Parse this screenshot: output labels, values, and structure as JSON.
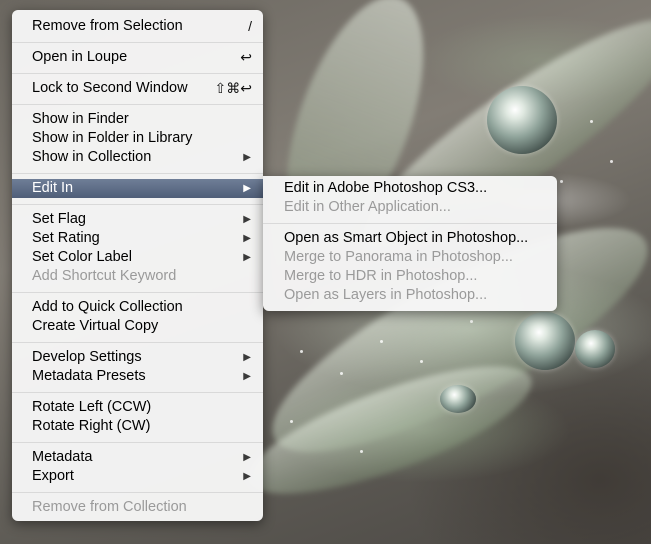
{
  "main_menu": {
    "items": [
      {
        "label": "Remove from Selection",
        "shortcut": "/"
      },
      {
        "label": "Open in Loupe",
        "shortcut": "↩"
      },
      {
        "label": "Lock to Second Window",
        "shortcut": "⇧⌘↩"
      },
      {
        "label": "Show in Finder"
      },
      {
        "label": "Show in Folder in Library"
      },
      {
        "label": "Show in Collection",
        "arrow": "▶"
      },
      {
        "label": "Edit In",
        "arrow": "▶"
      },
      {
        "label": "Set Flag",
        "arrow": "▶"
      },
      {
        "label": "Set Rating",
        "arrow": "▶"
      },
      {
        "label": "Set Color Label",
        "arrow": "▶"
      },
      {
        "label": "Add Shortcut Keyword"
      },
      {
        "label": "Add to Quick Collection"
      },
      {
        "label": "Create Virtual Copy"
      },
      {
        "label": "Develop Settings",
        "arrow": "▶"
      },
      {
        "label": "Metadata Presets",
        "arrow": "▶"
      },
      {
        "label": "Rotate Left (CCW)"
      },
      {
        "label": "Rotate Right (CW)"
      },
      {
        "label": "Metadata",
        "arrow": "▶"
      },
      {
        "label": "Export",
        "arrow": "▶"
      },
      {
        "label": "Remove from Collection"
      }
    ]
  },
  "submenu": {
    "items": [
      {
        "label": "Edit in Adobe Photoshop CS3..."
      },
      {
        "label": "Edit in Other Application..."
      },
      {
        "label": "Open as Smart Object in Photoshop..."
      },
      {
        "label": "Merge to Panorama in Photoshop..."
      },
      {
        "label": "Merge to HDR in Photoshop..."
      },
      {
        "label": "Open as Layers in Photoshop..."
      }
    ]
  },
  "colors": {
    "menu_background": "#f6f6f6",
    "highlight": "#5a6984",
    "disabled_text": "#9a9a9a"
  }
}
